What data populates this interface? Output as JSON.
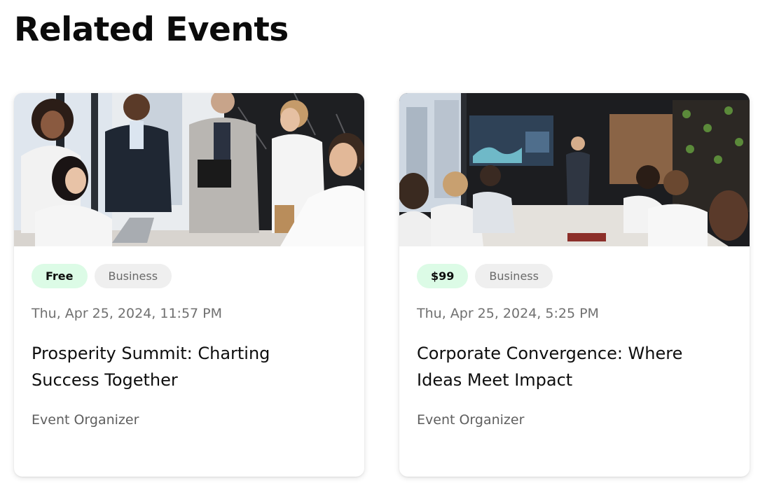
{
  "section": {
    "title": "Related Events"
  },
  "events": [
    {
      "image_alt": "Business team meeting around a laptop in an office",
      "price": "Free",
      "category": "Business",
      "datetime": "Thu, Apr 25, 2024, 11:57 PM",
      "title": "Prosperity Summit: Charting Success Together",
      "organizer": "Event Organizer"
    },
    {
      "image_alt": "Presenter in a conference room showing statistics on a screen",
      "price": "$99",
      "category": "Business",
      "datetime": "Thu, Apr 25, 2024, 5:25 PM",
      "title": "Corporate Convergence: Where Ideas Meet Impact",
      "organizer": "Event Organizer"
    }
  ],
  "colors": {
    "price_tag_bg": "#dcfbe6",
    "category_tag_bg": "#efefef",
    "muted_text": "#707070"
  }
}
